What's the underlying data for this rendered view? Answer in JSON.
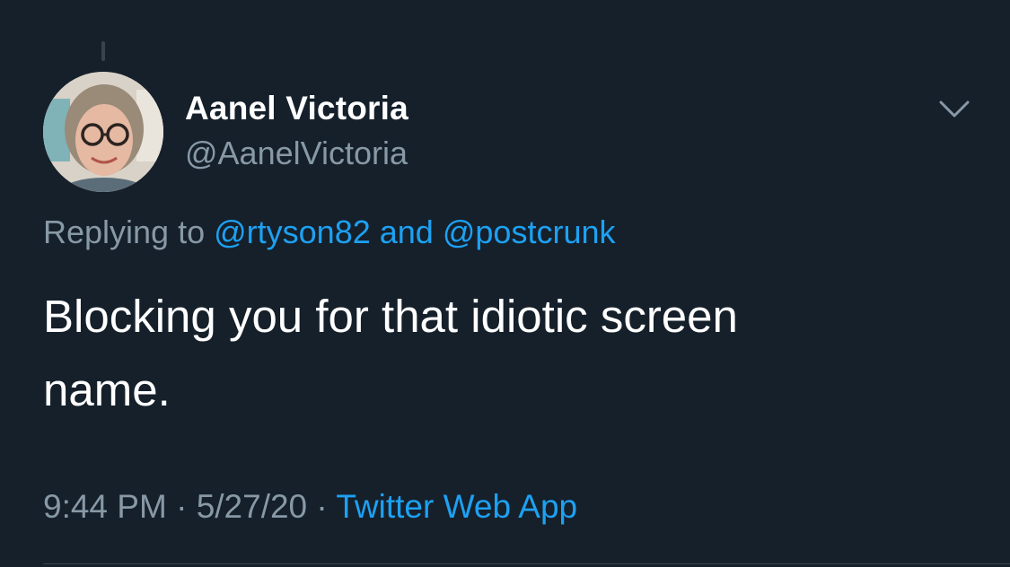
{
  "tweet": {
    "author": {
      "display_name": "Aanel Victoria",
      "handle": "@AanelVictoria",
      "avatar": "profile-photo"
    },
    "menu_icon": "chevron-down-icon",
    "replying_to": {
      "prefix": "Replying to",
      "users": [
        "@rtyson82",
        "@postcrunk"
      ],
      "conjunction": "and"
    },
    "text_line_1": "Blocking you for that idiotic screen",
    "text_line_2": "name.",
    "meta": {
      "time": "9:44 PM",
      "separator": "·",
      "date": "5/27/20",
      "source": "Twitter Web App"
    }
  },
  "colors": {
    "background": "#15202b",
    "primary_text": "#ffffff",
    "secondary_text": "#8899a6",
    "link": "#1da1f2",
    "divider": "#38444d"
  }
}
